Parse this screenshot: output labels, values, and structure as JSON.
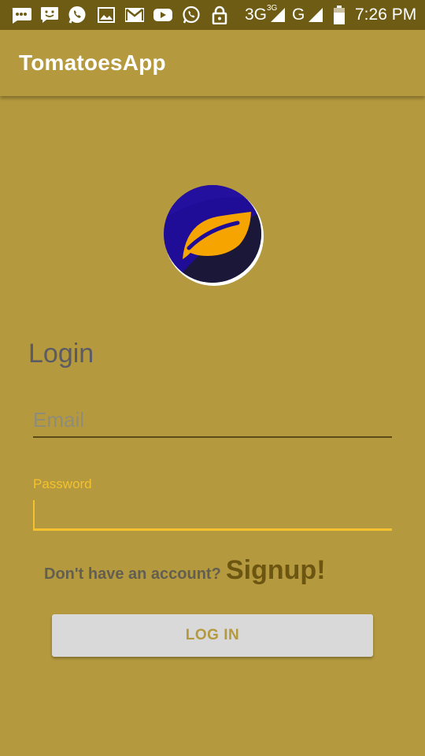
{
  "status_bar": {
    "network_primary": "3G",
    "network_primary_sup": "3G",
    "network_secondary": "G",
    "time": "7:26 PM",
    "icons": [
      "message-icon",
      "sms-icon",
      "whatsapp-icon",
      "gallery-icon",
      "gmail-icon",
      "youtube-icon",
      "whatsapp-icon",
      "lock-icon",
      "signal-icon",
      "signal-icon",
      "battery-icon"
    ]
  },
  "app_bar": {
    "title": "TomatoesApp"
  },
  "logo": {
    "icon": "leaf-icon",
    "colors": {
      "circle": "#1a0a8c",
      "leaf": "#f6a500",
      "border": "#ffffff"
    }
  },
  "login_form": {
    "heading": "Login",
    "email_placeholder": "Email",
    "email_value": "",
    "password_label": "Password",
    "password_value": "",
    "signup_prompt": "Don't have an account?",
    "signup_link": "Signup!",
    "login_button": "LOG IN"
  },
  "colors": {
    "background": "#b4993e",
    "status_bar": "#6f5c14",
    "accent": "#f4c22e",
    "button_bg": "#d8d9d8"
  }
}
